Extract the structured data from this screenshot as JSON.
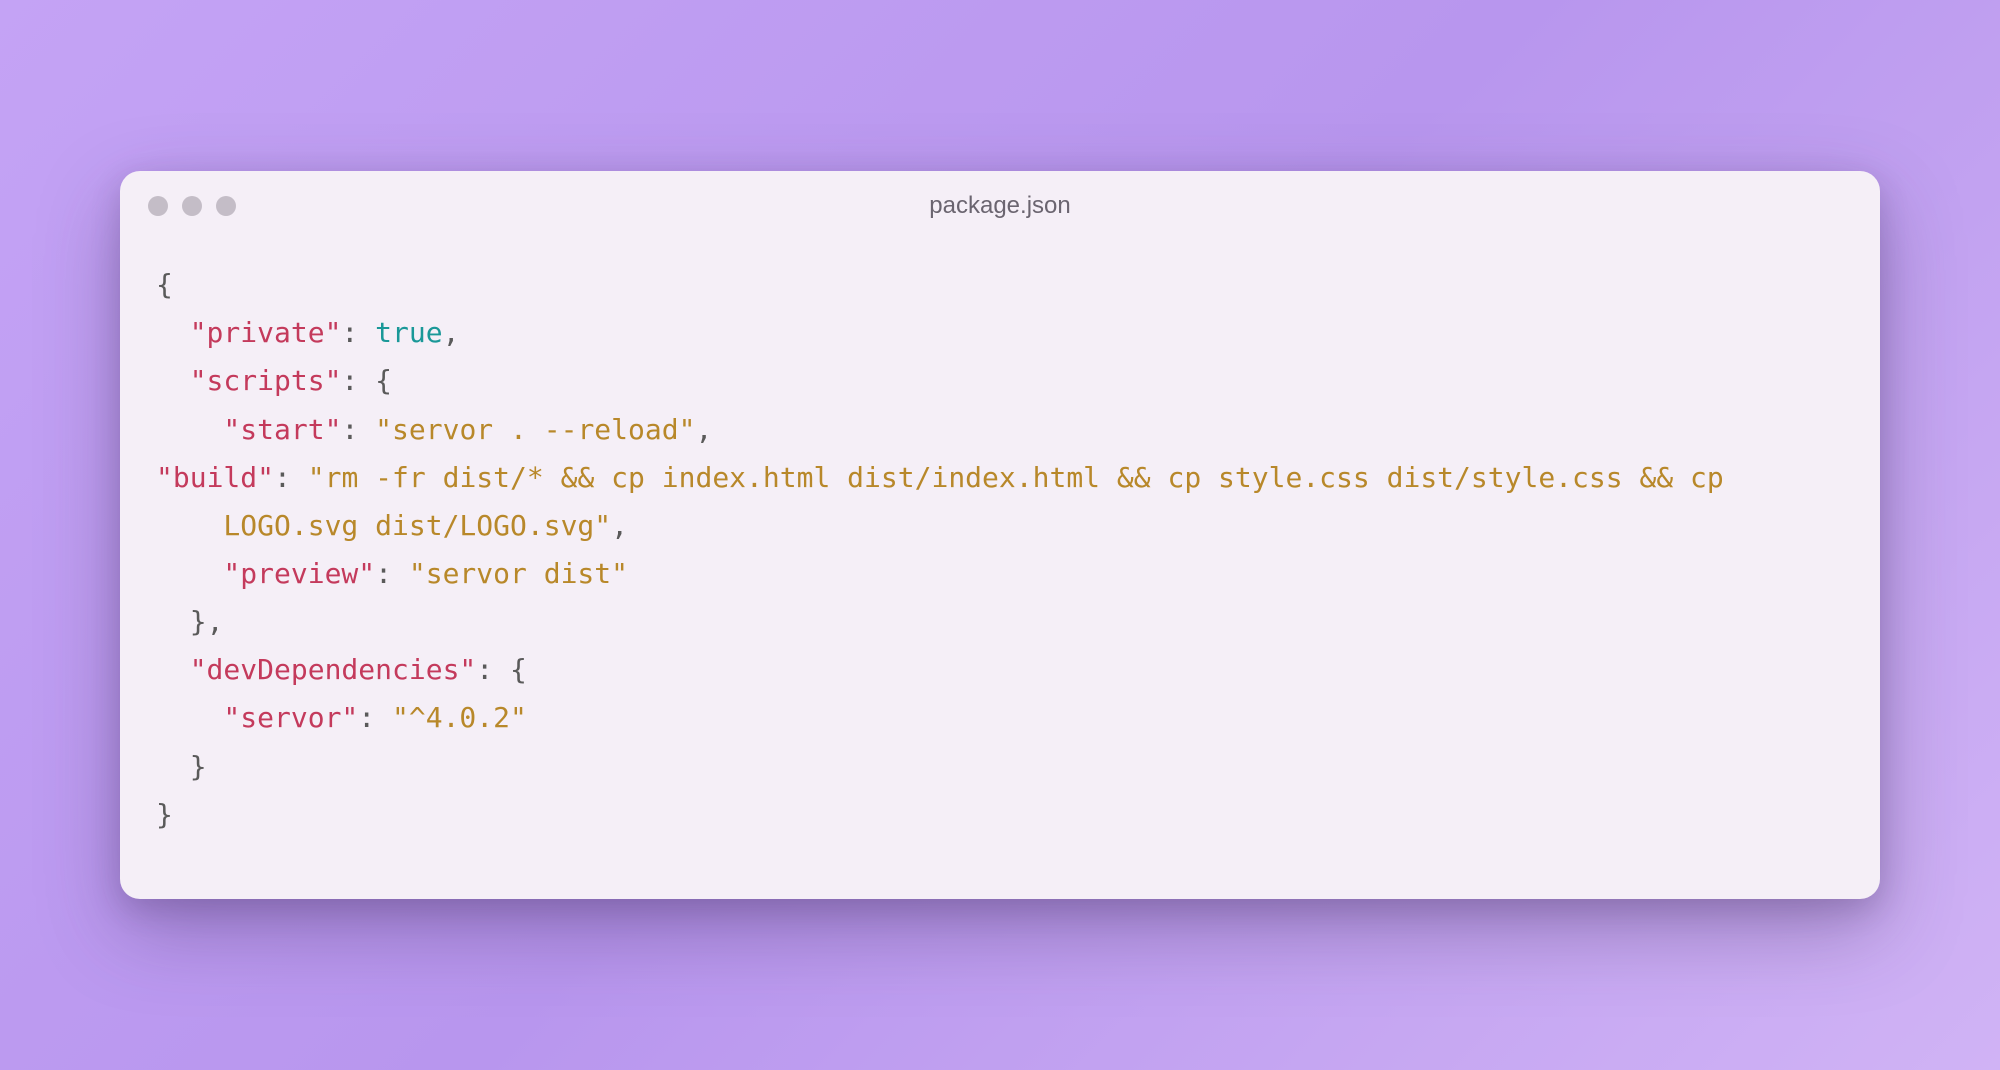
{
  "window": {
    "title": "package.json"
  },
  "code": {
    "brace_open": "{",
    "brace_close": "}",
    "private_key": "\"private\"",
    "private_sep": ": ",
    "private_val": "true",
    "private_end": ",",
    "scripts_key": "\"scripts\"",
    "scripts_sep": ": ",
    "scripts_open": "{",
    "start_key": "\"start\"",
    "start_sep": ": ",
    "start_val": "\"servor . --reload\"",
    "start_end": ",",
    "build_key": "\"build\"",
    "build_sep": ": ",
    "build_val": "\"rm -fr dist/* && cp index.html dist/index.html && cp style.css dist/style.css && cp LOGO.svg dist/LOGO.svg\"",
    "build_end": ",",
    "preview_key": "\"preview\"",
    "preview_sep": ": ",
    "preview_val": "\"servor dist\"",
    "scripts_close": "}",
    "scripts_end": ",",
    "devdeps_key": "\"devDependencies\"",
    "devdeps_sep": ": ",
    "devdeps_open": "{",
    "servor_key": "\"servor\"",
    "servor_sep": ": ",
    "servor_val": "\"^4.0.2\"",
    "devdeps_close": "}"
  }
}
